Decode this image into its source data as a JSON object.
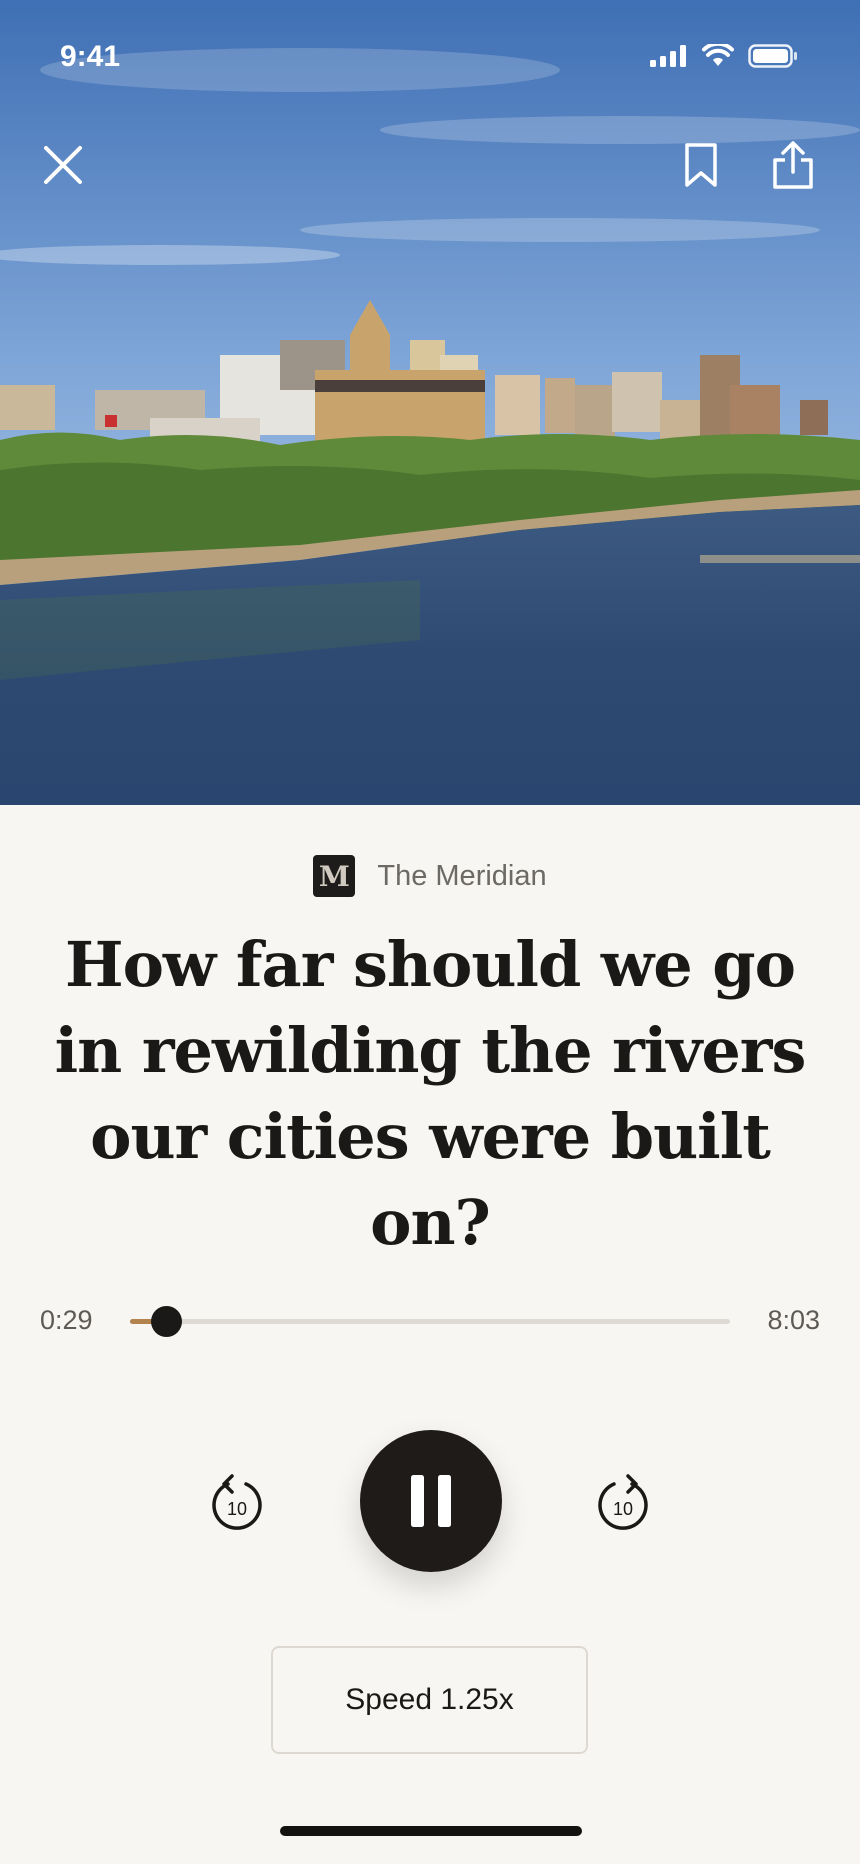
{
  "status_bar": {
    "time": "9:41"
  },
  "icons": {
    "close": "close-icon",
    "bookmark": "bookmark-icon",
    "share": "share-icon",
    "rewind": "rewind-10-icon",
    "forward": "forward-10-icon",
    "pause": "pause-icon"
  },
  "article": {
    "publication_logo": "M",
    "publication_name": "The Meridian",
    "headline": "How far should we go in rewilding the rivers our cities were built on?"
  },
  "player": {
    "elapsed": "0:29",
    "duration": "8:03",
    "progress": 0.06,
    "skip_back_label": "10",
    "skip_forward_label": "10",
    "speed_label": "Speed 1.25x"
  },
  "colors": {
    "accent": "#b2824f",
    "background": "#f8f6f2",
    "text": "#1b1917"
  }
}
